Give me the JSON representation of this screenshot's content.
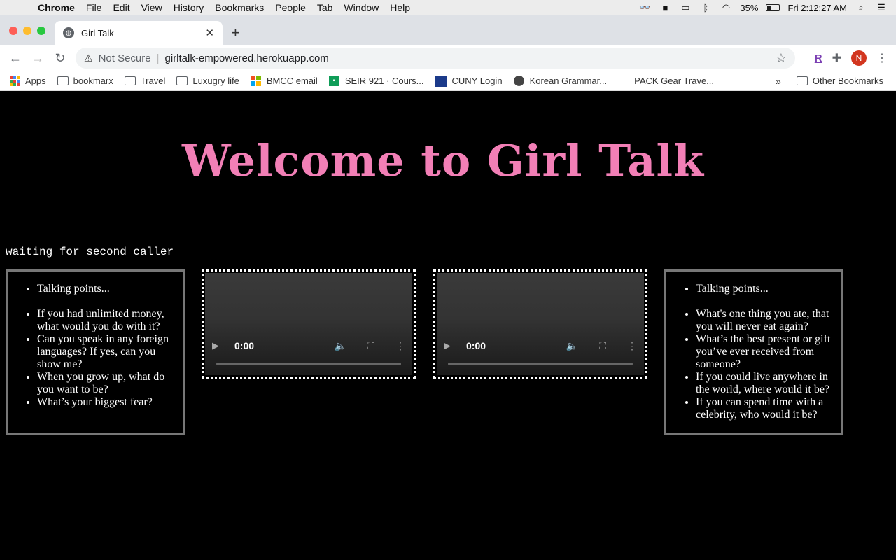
{
  "menubar": {
    "app_name": "Chrome",
    "items": [
      "File",
      "Edit",
      "View",
      "History",
      "Bookmarks",
      "People",
      "Tab",
      "Window",
      "Help"
    ],
    "battery": "35%",
    "clock": "Fri 2:12:27 AM"
  },
  "tab": {
    "title": "Girl Talk",
    "new_tab_label": "+"
  },
  "toolbar": {
    "security_label": "Not Secure",
    "url": "girltalk-empowered.herokuapp.com",
    "profile_initial": "N",
    "extension_label": "R"
  },
  "bookmarks": {
    "items": [
      "Apps",
      "bookmarx",
      "Travel",
      "Luxugry life",
      "BMCC email",
      "SEIR 921 · Cours...",
      "CUNY Login",
      "Korean Grammar...",
      "PACK Gear Trave..."
    ],
    "overflow": "»",
    "other": "Other Bookmarks"
  },
  "page": {
    "title": "Welcome to Girl Talk",
    "status": "waiting for second caller",
    "left_points": {
      "header": "Talking points...",
      "items": [
        "If you had unlimited money, what would you do with it?",
        "Can you speak in any foreign languages? If yes, can you show me?",
        "When you grow up, what do you want to be?",
        "What’s your biggest fear?"
      ]
    },
    "right_points": {
      "header": "Talking points...",
      "items": [
        "What's one thing you ate, that you will never eat again?",
        "What’s the best present or gift you’ve ever received from someone?",
        "If you could live anywhere in the world, where would it be?",
        "If you can spend time with a celebrity, who would it be?"
      ]
    },
    "video_time": "0:00"
  },
  "colors": {
    "title_pink": "#f27fb6",
    "background": "#000000"
  }
}
